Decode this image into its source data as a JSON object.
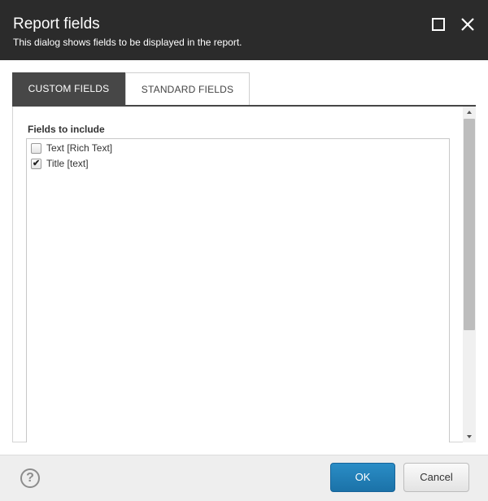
{
  "dialog": {
    "title": "Report fields",
    "subtitle": "This dialog shows fields to be displayed in the report."
  },
  "header_icons": {
    "maximize": "maximize-icon",
    "close": "close-icon"
  },
  "tabs": [
    {
      "label": "CUSTOM FIELDS",
      "active": true
    },
    {
      "label": "STANDARD FIELDS",
      "active": false
    }
  ],
  "panel": {
    "section_label": "Fields to include",
    "fields": [
      {
        "label": "Text [Rich Text]",
        "checked": false
      },
      {
        "label": "Title [text]",
        "checked": true
      }
    ]
  },
  "footer": {
    "help_icon": "question-circle-icon",
    "help_glyph": "?",
    "ok_label": "OK",
    "cancel_label": "Cancel"
  },
  "colors": {
    "header_bg": "#2b2b2b",
    "active_tab": "#474747",
    "primary_button": "#1b72a8"
  }
}
